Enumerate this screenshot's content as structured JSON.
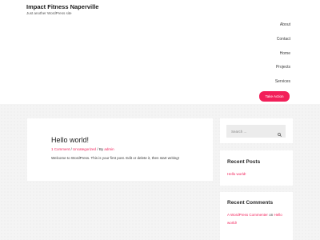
{
  "site": {
    "title": "Impact Fitness Naperville",
    "tagline": "Just another WordPress site"
  },
  "nav": {
    "items": [
      "About",
      "Contact",
      "Home",
      "Projects",
      "Services"
    ],
    "cta": "Take Action"
  },
  "post": {
    "title": "Hello world!",
    "meta_comments": "1 Comment",
    "meta_sep1": " / ",
    "meta_category": "Uncategorized",
    "meta_sep2": " / By ",
    "meta_author": "admin",
    "excerpt": "Welcome to WordPress. This is your first post. Edit or delete it, then start writing!"
  },
  "sidebar": {
    "search_placeholder": "Search ...",
    "recent_posts_title": "Recent Posts",
    "recent_posts": [
      "Hello world!"
    ],
    "recent_comments_title": "Recent Comments",
    "comment_author": "A WordPress Commenter",
    "comment_on": " on ",
    "comment_post_part1": "Hello",
    "comment_post_part2": "world!"
  },
  "colors": {
    "accent": "#f21f59",
    "background": "#f4f4f4"
  },
  "icons": {
    "search": "magnifier-icon"
  }
}
